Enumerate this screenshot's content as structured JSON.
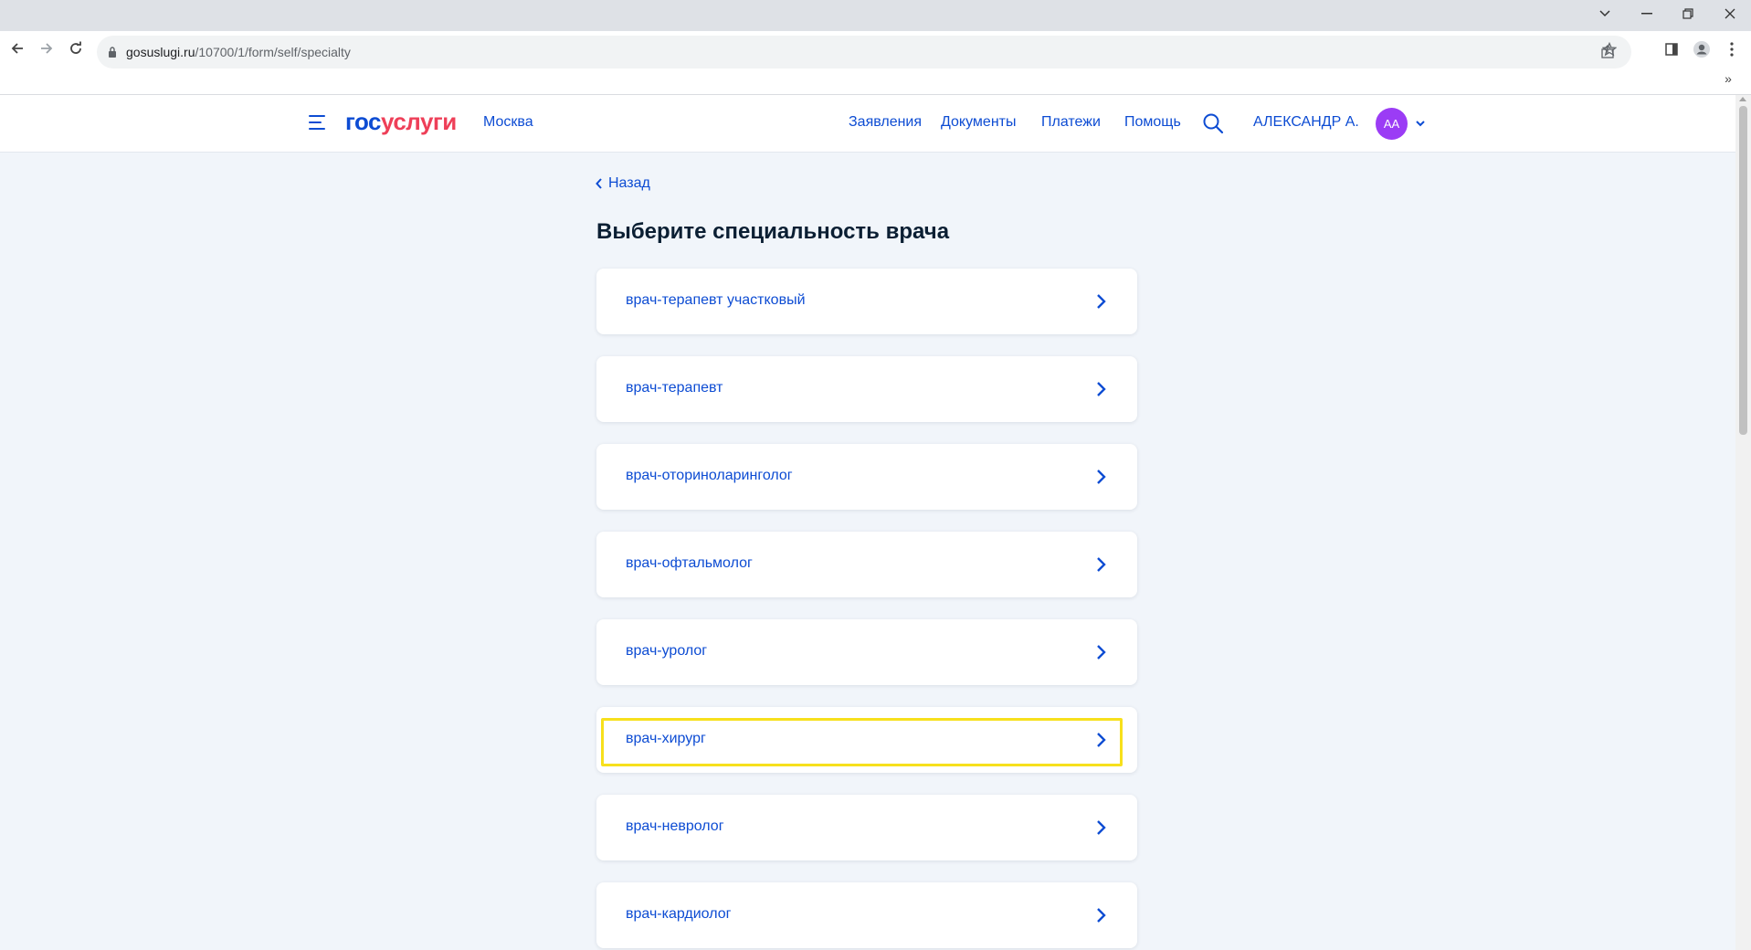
{
  "browser": {
    "url_host": "gosuslugi.ru",
    "url_path": "/10700/1/form/self/specialty",
    "overflow_chevron": "»"
  },
  "header": {
    "logo_part1": "гос",
    "logo_part2": "услуги",
    "region": "Москва",
    "nav": [
      "Заявления",
      "Документы",
      "Платежи",
      "Помощь"
    ],
    "username": "АЛЕКСАНДР А.",
    "avatar_initials": "АА",
    "colors": {
      "brand_blue": "#0d4cd3",
      "brand_red": "#ee3f58",
      "avatar": "#9b3cf5"
    }
  },
  "main": {
    "back_label": "Назад",
    "title": "Выберите специальность врача",
    "specialties": [
      "врач-терапевт участковый",
      "врач-терапевт",
      "врач-оториноларинголог",
      "врач-офтальмолог",
      "врач-уролог",
      "врач-хирург",
      "врач-невролог",
      "врач-кардиолог"
    ],
    "highlighted_index": 5,
    "highlight_color": "#f7e01c"
  }
}
